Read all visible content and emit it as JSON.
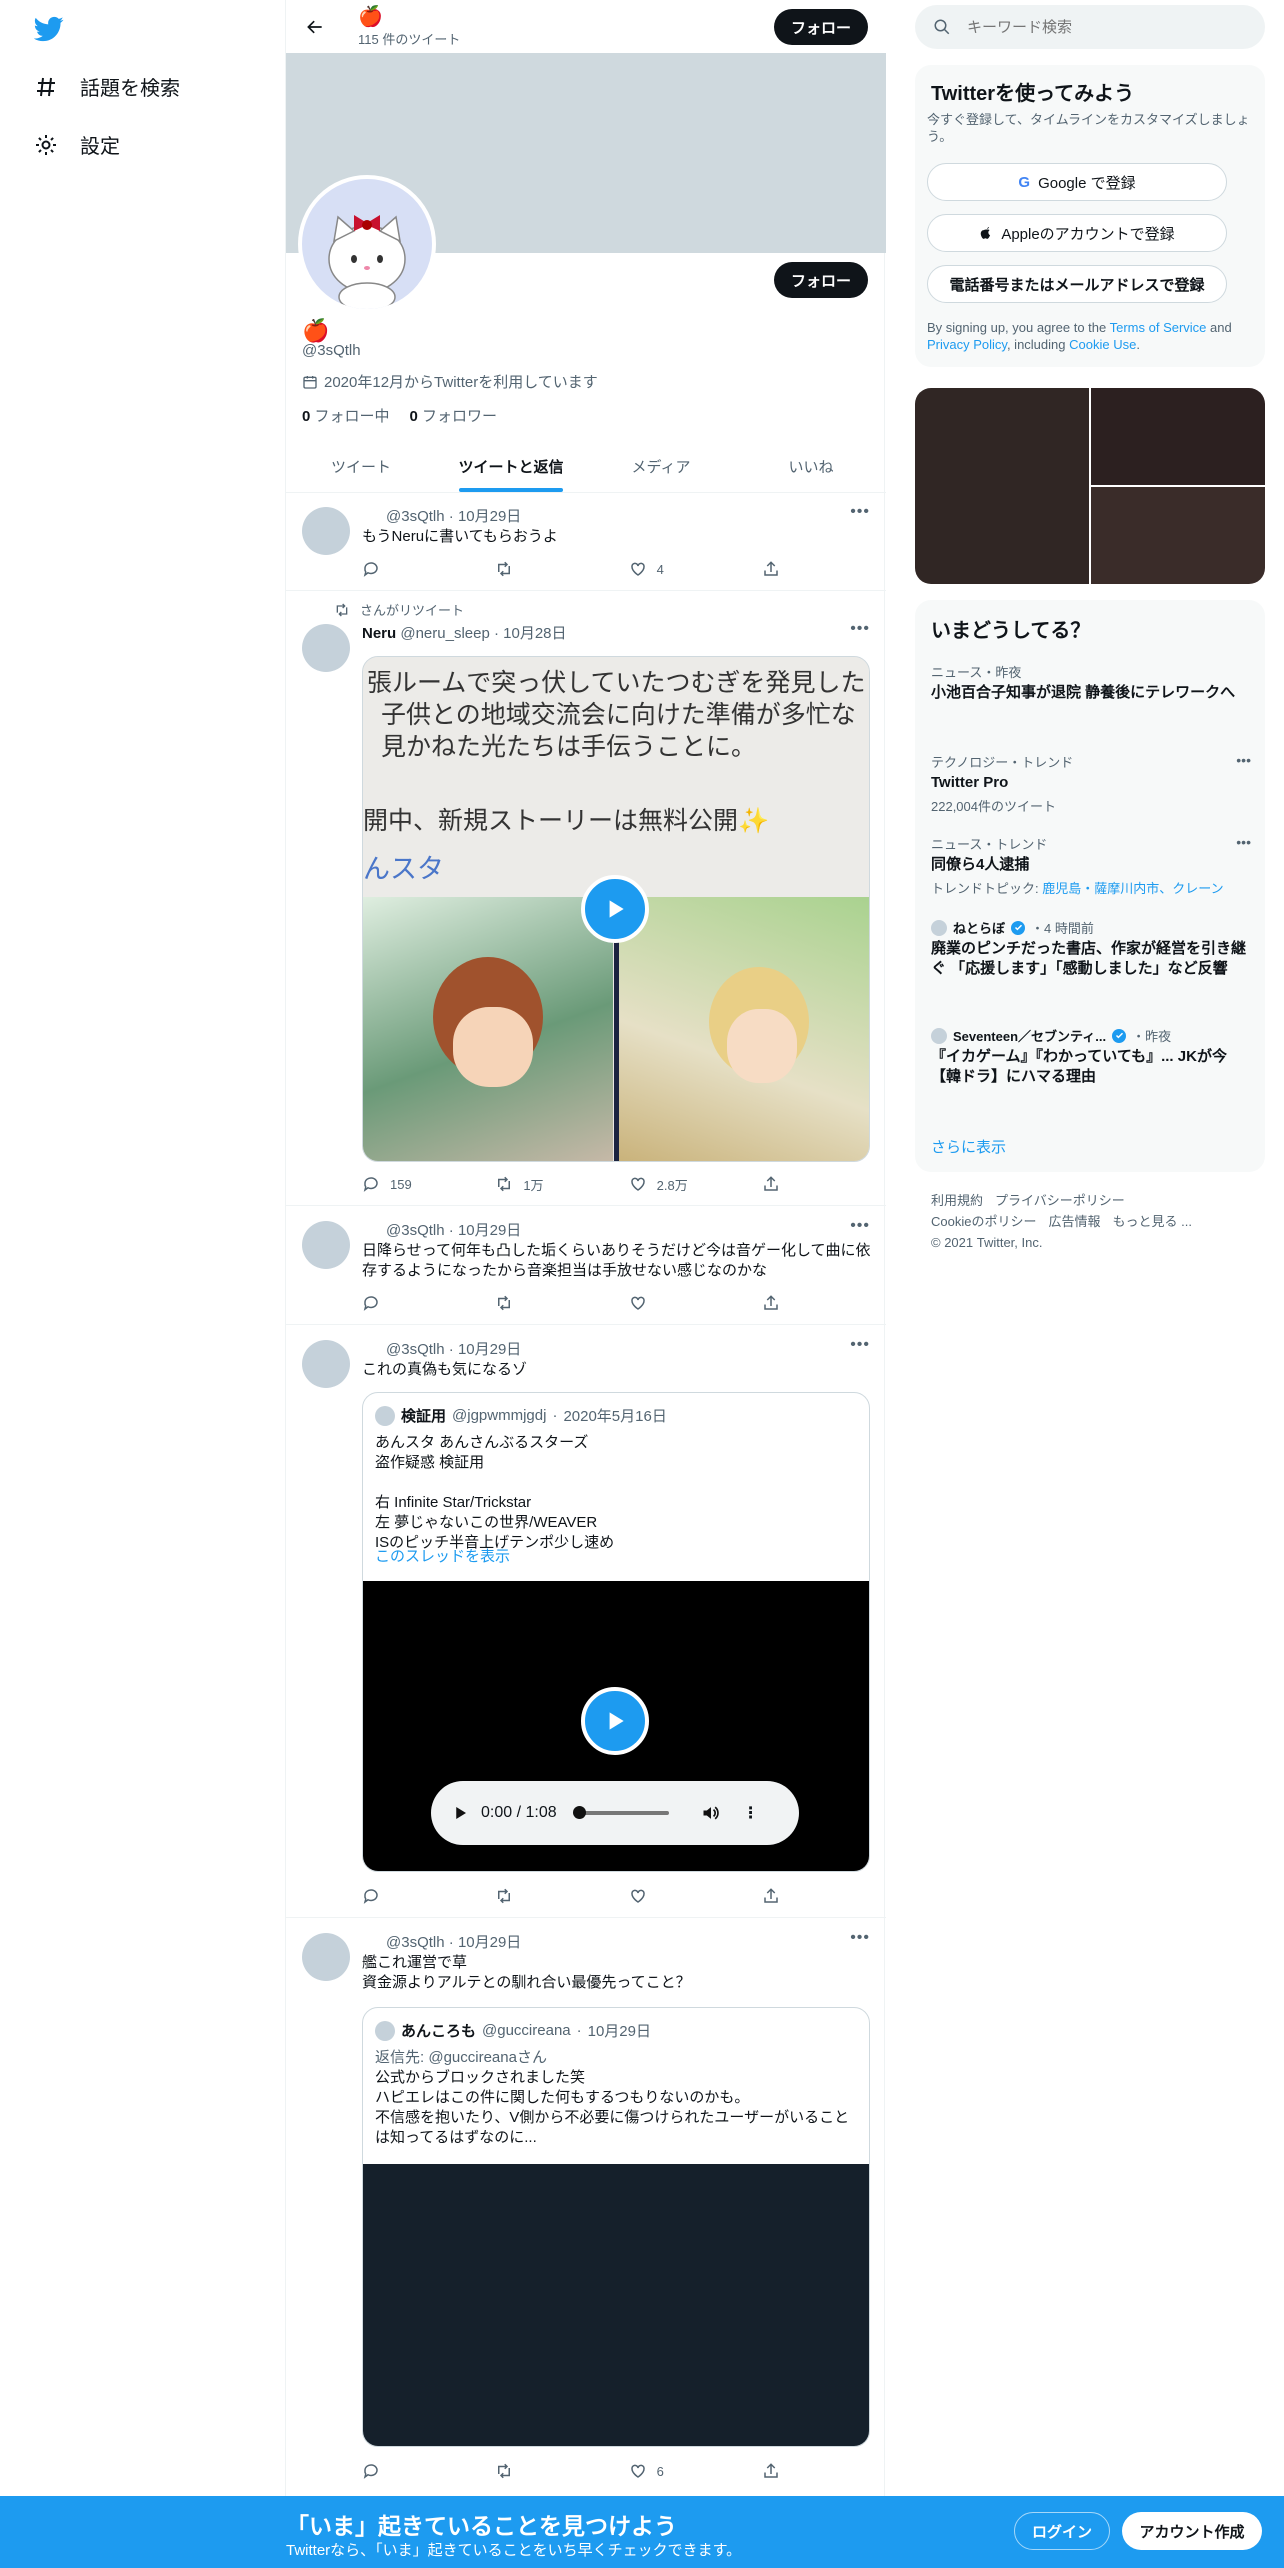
{
  "nav": {
    "logo_icon": "twitter-bird-icon",
    "items": [
      {
        "label": "話題を検索",
        "icon": "hashtag-icon"
      },
      {
        "label": "設定",
        "icon": "gear-icon"
      }
    ]
  },
  "profile": {
    "display_name": "🍎",
    "tweet_count": "115 件のツイート",
    "follow_label": "フォロー",
    "handle": "@3sQtlh",
    "joined": "2020年12月からTwitterを利用しています",
    "following_count": "0",
    "following_label": "フォロー中",
    "followers_count": "0",
    "followers_label": "フォロワー"
  },
  "tabs": [
    {
      "label": "ツイート",
      "active": false
    },
    {
      "label": "ツイートと返信",
      "active": true
    },
    {
      "label": "メディア",
      "active": false
    },
    {
      "label": "いいね",
      "active": false
    }
  ],
  "tweets": [
    {
      "author": "",
      "handle": "@3sQtlh",
      "date": "10月29日",
      "text": "もうNeruに書いてもらおうよ",
      "reply": "",
      "retweet": "",
      "like": "4"
    },
    {
      "retweet_label": "さんがリツイート",
      "author": "Neru",
      "handle": "@neru_sleep",
      "date": "10月28日",
      "media_text_lines": [
        "張ルームで突っ伏していたつむぎを発見した",
        "子供との地域交流会に向けた準備が多忙な",
        "見かねた光たちは手伝うことに。",
        "開中、新規ストーリーは無料公開",
        "んスタ"
      ],
      "reply": "159",
      "retweet": "1万",
      "like": "2.8万"
    },
    {
      "author": "",
      "handle": "@3sQtlh",
      "date": "10月29日",
      "text": "日降らせって何年も凸した垢くらいありそうだけど今は音ゲー化して曲に依存するようになったから音楽担当は手放せない感じなのかな",
      "reply": "",
      "retweet": "",
      "like": ""
    },
    {
      "author": "",
      "handle": "@3sQtlh",
      "date": "10月29日",
      "text": "これの真偽も気になるゾ",
      "quote": {
        "name": "検証用",
        "handle": "@jgpwmmjgdj",
        "date": "2020年5月16日",
        "text": "あんスタ あんさんぶるスターズ\n盗作疑惑 検証用\n\n右 Infinite Star/Trickstar\n左 夢じゃないこの世界/WEAVER\nISのピッチ半音上げテンポ少し速め",
        "thread_link": "このスレッドを表示",
        "audio_time": "0:00 / 1:08",
        "audio_progress": 0
      },
      "reply": "",
      "retweet": "",
      "like": ""
    },
    {
      "author": "",
      "handle": "@3sQtlh",
      "date": "10月29日",
      "text": "艦これ運営で草\n資金源よりアルテとの馴れ合い最優先ってこと？",
      "quote": {
        "name": "あんころも",
        "handle": "@guccireana",
        "date": "10月29日",
        "reply_to_prefix": "返信先: ",
        "reply_to_handle": "@guccireana",
        "reply_to_suffix": "さん",
        "text": "公式からブロックされました笑\nハピエレはこの件に関した何もするつもりないのかも。\n不信感を抱いたり、V側から不必要に傷つけられたユーザーがいることは知ってるはずなのに..."
      },
      "reply": "",
      "retweet": "",
      "like": "6"
    }
  ],
  "search": {
    "placeholder": "キーワード検索"
  },
  "signup_card": {
    "title": "Twitterを使ってみよう",
    "subtitle": "今すぐ登録して、タイムラインをカスタマイズしましょう。",
    "google_label": "Google で登録",
    "apple_label": "Appleのアカウントで登録",
    "phone_label": "電話番号またはメールアドレスで登録",
    "terms_prefix": "By signing up, you agree to the ",
    "terms_link": "Terms of Service",
    "terms_and": " and ",
    "privacy_link": "Privacy Policy",
    "terms_including": ", including ",
    "cookie_link": "Cookie Use",
    "terms_end": "."
  },
  "trends_card": {
    "title": "いまどうしてる？",
    "items": [
      {
        "meta": "ニュース・昨夜",
        "title": "小池百合子知事が退院 静養後にテレワークへ"
      },
      {
        "meta": "テクノロジー・トレンド",
        "title": "Twitter Pro",
        "sub": "222,004件のツイート"
      },
      {
        "meta": "ニュース・トレンド",
        "title": "同僚ら4人逮捕",
        "sub_prefix": "トレンドトピック: ",
        "sub_links": "鹿児島・薩摩川内市、クレーン"
      },
      {
        "meta_name": "ねとらぼ",
        "meta": "・4 時間前",
        "title": "廃業のピンチだった書店、作家が経営を引き継ぐ 「応援します」「感動しました」など反響"
      },
      {
        "meta_name": "Seventeen／セブンティ...",
        "meta": "・昨夜",
        "title": "『イカゲーム』『わかっていても』... JKが今【韓ドラ】にハマる理由"
      }
    ],
    "show_more": "さらに表示"
  },
  "footer": {
    "links": [
      "利用規約",
      "プライバシーポリシー",
      "Cookieのポリシー",
      "広告情報",
      "もっと見る ..."
    ],
    "copyright": "© 2021 Twitter, Inc."
  },
  "bottom_bar": {
    "title": "「いま」起きていることを見つけよう",
    "subtitle": "Twitterなら、「いま」起きていることをいち早くチェックできます。",
    "login_label": "ログイン",
    "signup_label": "アカウント作成"
  },
  "colors": {
    "accent": "#1d9bf0",
    "banner": "#cfd9de",
    "text": "#0f1419",
    "muted": "#536471"
  }
}
